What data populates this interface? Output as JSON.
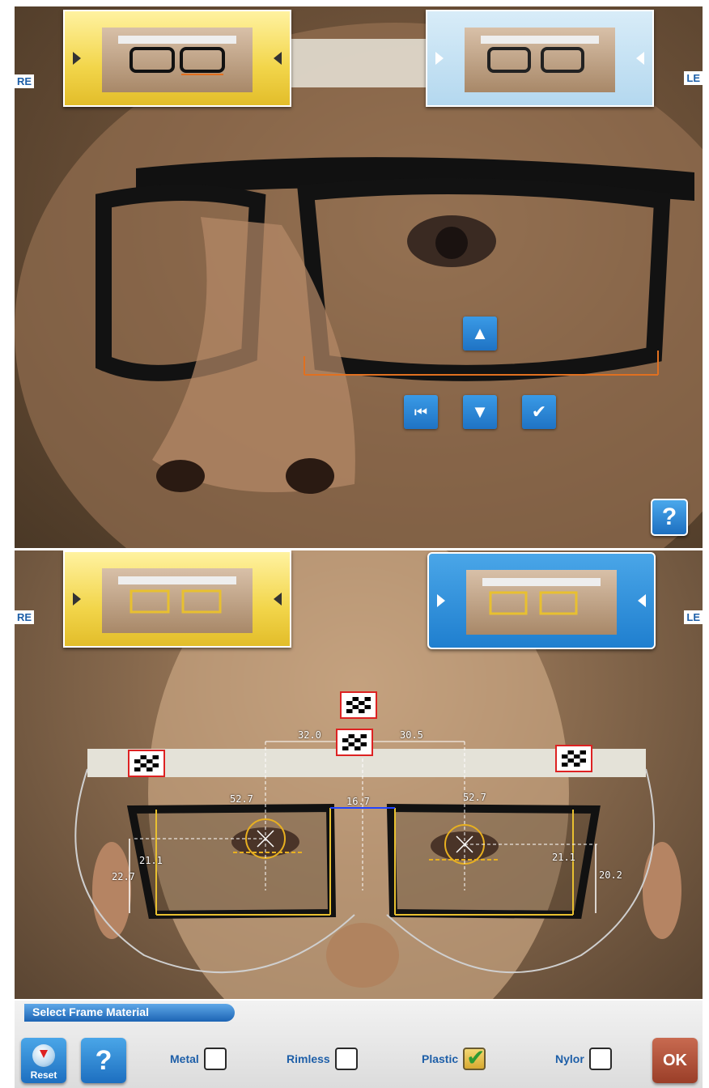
{
  "top_panel": {
    "left_eye_label": "RE",
    "right_eye_label": "LE",
    "help_label": "?",
    "controls": {
      "up_icon": "triangle-up",
      "down_icon": "triangle-down",
      "first_icon": "skip-to-start",
      "confirm_icon": "checkmark"
    }
  },
  "bottom_panel": {
    "left_eye_label": "RE",
    "right_eye_label": "LE",
    "measurements": {
      "pd_right": "32.0",
      "pd_left": "30.5",
      "bridge": "16.7",
      "width_right": "52.7",
      "width_left": "52.7",
      "height_right_inner": "21.1",
      "height_left_inner": "21.1",
      "height_right_outer": "22.7",
      "height_left_outer": "20.2"
    }
  },
  "bottom_bar": {
    "title": "Select Frame Material",
    "reset_label": "Reset",
    "help_label": "?",
    "ok_label": "OK",
    "materials": [
      {
        "label": "Metal",
        "checked": false
      },
      {
        "label": "Rimless",
        "checked": false
      },
      {
        "label": "Plastic",
        "checked": true
      },
      {
        "label": "Nylor",
        "checked": false
      }
    ]
  },
  "colors": {
    "accent_blue": "#1f7fcf",
    "thumb_yellow": "#f2d54a",
    "ok_red": "#9a3e28",
    "marker_red": "#dd2222"
  }
}
